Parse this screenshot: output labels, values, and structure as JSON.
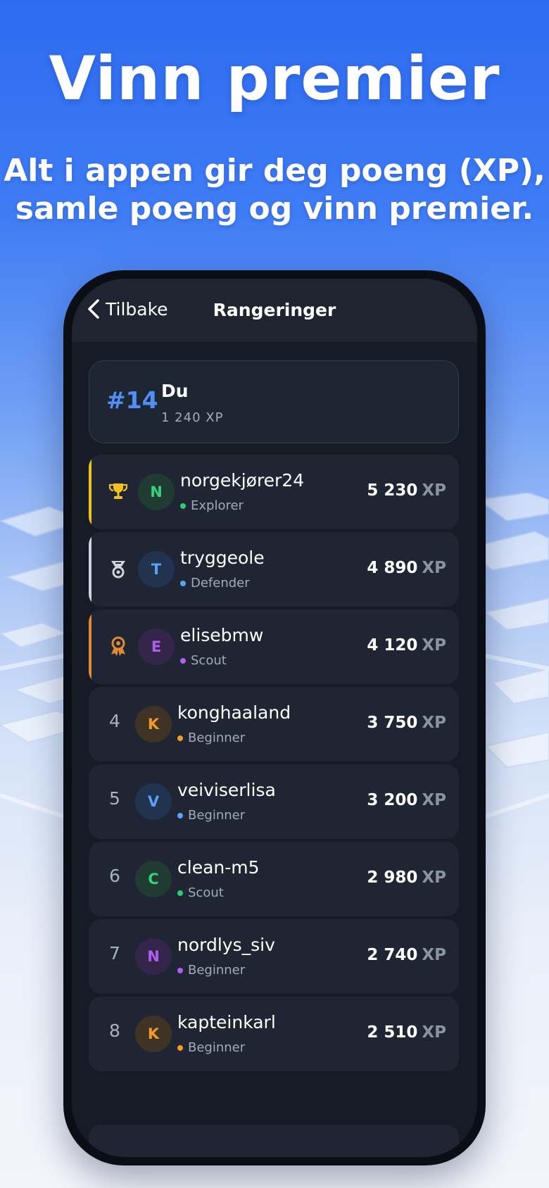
{
  "hero": {
    "title": "Vinn premier",
    "subtitle_line1": "Alt i appen gir deg poeng (XP),",
    "subtitle_line2": "samle poeng og vinn premier."
  },
  "nav": {
    "back_label": "Tilbake",
    "title": "Rangeringer"
  },
  "me": {
    "rank": "#14",
    "name": "Du",
    "xp": "1 240 XP"
  },
  "xp_unit": "XP",
  "colors": {
    "gold": "#f2c11f",
    "silver": "#cfd4db",
    "bronze": "#e08a34",
    "accent_blue": "#4f8ff7"
  },
  "leaderboard": [
    {
      "rank": "1",
      "medal": "trophy-icon",
      "avatar_letter": "N",
      "username": "norgekjører24",
      "tier": "Explorer",
      "tier_color": "#2ecc71",
      "avatar_bg": "#1f3b32",
      "avatar_fg": "#34d27a",
      "xp": "5 230"
    },
    {
      "rank": "2",
      "medal": "silver-medal-icon",
      "avatar_letter": "T",
      "username": "tryggeole",
      "tier": "Defender",
      "tier_color": "#5aa2f5",
      "avatar_bg": "#223350",
      "avatar_fg": "#5aa2f5",
      "xp": "4 890"
    },
    {
      "rank": "3",
      "medal": "bronze-medal-icon",
      "avatar_letter": "E",
      "username": "elisebmw",
      "tier": "Scout",
      "tier_color": "#b15ef0",
      "avatar_bg": "#33264a",
      "avatar_fg": "#b15ef0",
      "xp": "4 120"
    },
    {
      "rank": "4",
      "avatar_letter": "K",
      "username": "konghaaland",
      "tier": "Beginner",
      "tier_color": "#f39a27",
      "avatar_bg": "#3f3326",
      "avatar_fg": "#f39a27",
      "xp": "3 750"
    },
    {
      "rank": "5",
      "avatar_letter": "V",
      "username": "veiviserlisa",
      "tier": "Beginner",
      "tier_color": "#5aa2f5",
      "avatar_bg": "#223350",
      "avatar_fg": "#5aa2f5",
      "xp": "3 200"
    },
    {
      "rank": "6",
      "avatar_letter": "C",
      "username": "clean-m5",
      "tier": "Scout",
      "tier_color": "#2ecc71",
      "avatar_bg": "#1f3b32",
      "avatar_fg": "#34d27a",
      "xp": "2 980"
    },
    {
      "rank": "7",
      "avatar_letter": "N",
      "username": "nordlys_siv",
      "tier": "Beginner",
      "tier_color": "#b15ef0",
      "avatar_bg": "#33264a",
      "avatar_fg": "#b15ef0",
      "xp": "2 740"
    },
    {
      "rank": "8",
      "avatar_letter": "K",
      "username": "kapteinkarl",
      "tier": "Beginner",
      "tier_color": "#f39a27",
      "avatar_bg": "#3f3326",
      "avatar_fg": "#f39a27",
      "xp": "2 510"
    }
  ]
}
